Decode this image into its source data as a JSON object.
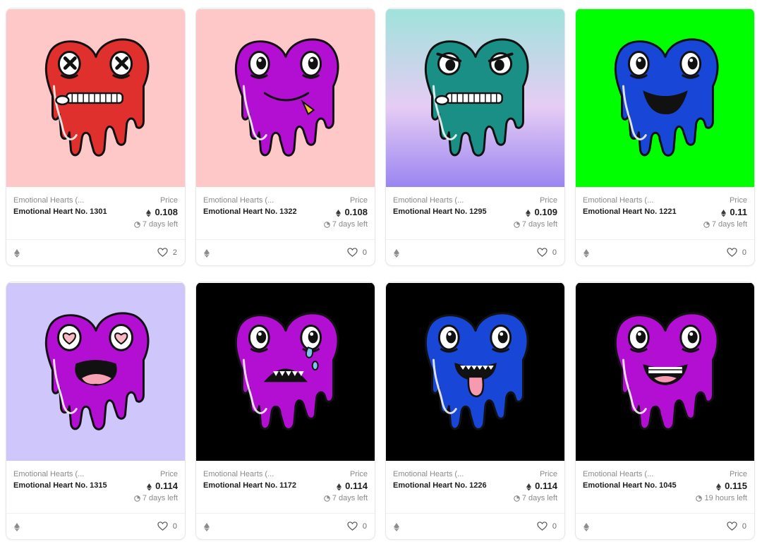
{
  "currency_icon": "ethereum-icon",
  "like_icon": "heart-outline-icon",
  "time_icon": "clock-icon",
  "cards": [
    {
      "collection": "Emotional Hearts (...",
      "name": "Emotional Heart No. 1301",
      "price_label": "Price",
      "price": "0.108",
      "time_left": "7 days left",
      "likes": "2",
      "bg": "#ffc8c8",
      "heart_color": "#e0302e",
      "eyes": "cross",
      "mouth": "zipper"
    },
    {
      "collection": "Emotional Hearts (...",
      "name": "Emotional Heart No. 1322",
      "price_label": "Price",
      "price": "0.108",
      "time_left": "7 days left",
      "likes": "0",
      "bg": "#ffc8c8",
      "heart_color": "#b30fd3",
      "eyes": "round",
      "mouth": "smirk"
    },
    {
      "collection": "Emotional Hearts (...",
      "name": "Emotional Heart No. 1295",
      "price_label": "Price",
      "price": "0.109",
      "time_left": "7 days left",
      "likes": "0",
      "bg": "gradient-teal-purple",
      "heart_color": "#1a8f85",
      "eyes": "angry",
      "mouth": "zipper"
    },
    {
      "collection": "Emotional Hearts (...",
      "name": "Emotional Heart No. 1221",
      "price_label": "Price",
      "price": "0.11",
      "time_left": "7 days left",
      "likes": "0",
      "bg": "#00ff00",
      "heart_color": "#1846d6",
      "eyes": "round",
      "mouth": "grin"
    },
    {
      "collection": "Emotional Hearts (...",
      "name": "Emotional Heart No. 1315",
      "price_label": "Price",
      "price": "0.114",
      "time_left": "7 days left",
      "likes": "0",
      "bg": "#cfc6fb",
      "heart_color": "#b30fd3",
      "eyes": "hearts",
      "mouth": "open"
    },
    {
      "collection": "Emotional Hearts (...",
      "name": "Emotional Heart No. 1172",
      "price_label": "Price",
      "price": "0.114",
      "time_left": "7 days left",
      "likes": "0",
      "bg": "#000000",
      "heart_color": "#b30fd3",
      "eyes": "crying",
      "mouth": "frown"
    },
    {
      "collection": "Emotional Hearts (...",
      "name": "Emotional Heart No. 1226",
      "price_label": "Price",
      "price": "0.114",
      "time_left": "7 days left",
      "likes": "0",
      "bg": "#000000",
      "heart_color": "#1846d6",
      "eyes": "round",
      "mouth": "tongue"
    },
    {
      "collection": "Emotional Hearts (...",
      "name": "Emotional Heart No. 1045",
      "price_label": "Price",
      "price": "0.115",
      "time_left": "19 hours left",
      "likes": "0",
      "bg": "#000000",
      "heart_color": "#b30fd3",
      "eyes": "round",
      "mouth": "braces"
    }
  ]
}
